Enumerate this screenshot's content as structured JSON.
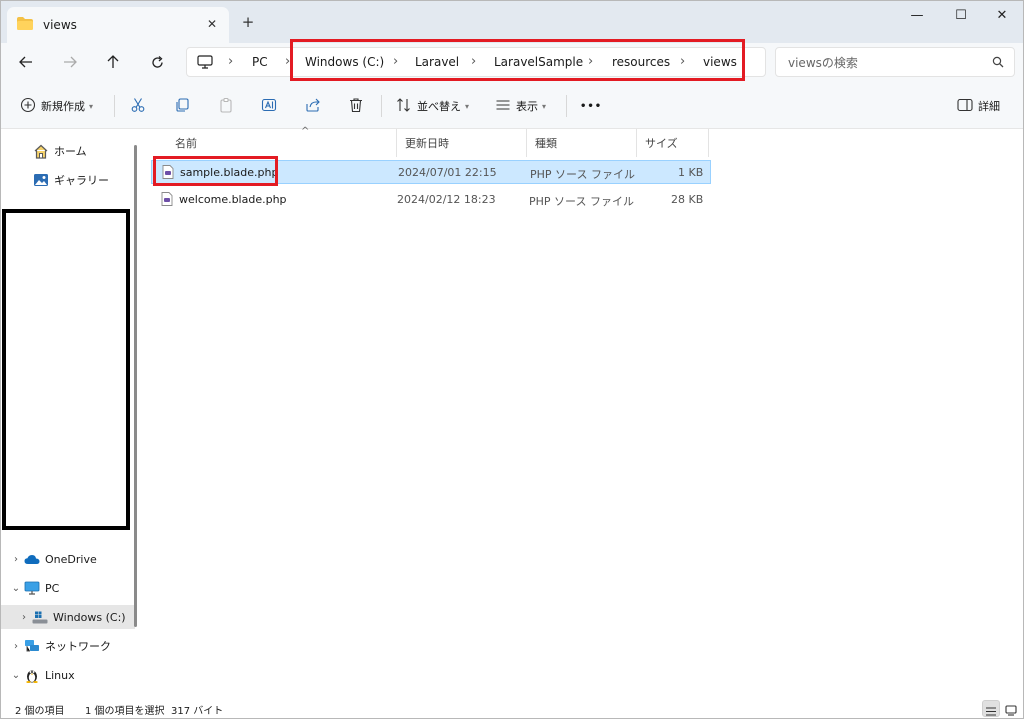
{
  "window": {
    "tab_title": "views",
    "new_tab_symbol": "+",
    "close_tab_symbol": "✕",
    "controls": {
      "minimize": "—",
      "maximize": "☐",
      "close": "✕"
    }
  },
  "address": {
    "breadcrumbs": [
      "PC",
      "Windows (C:)",
      "Laravel",
      "LaravelSample",
      "resources",
      "views"
    ],
    "search_placeholder": "viewsの検索"
  },
  "toolbar": {
    "new_label": "新規作成",
    "sort_label": "並べ替え",
    "view_label": "表示",
    "more_label": "•••",
    "details_label": "詳細"
  },
  "sidebar": {
    "quick": [
      {
        "label": "ホーム",
        "icon": "home-icon"
      },
      {
        "label": "ギャラリー",
        "icon": "gallery-icon"
      }
    ],
    "tree": [
      {
        "label": "OneDrive",
        "icon": "cloud-icon",
        "chevron": "›"
      },
      {
        "label": "PC",
        "icon": "pc-icon",
        "chevron": "⌄"
      },
      {
        "label": "Windows (C:)",
        "icon": "drive-icon",
        "chevron": "›",
        "selected": true
      },
      {
        "label": "ネットワーク",
        "icon": "network-icon",
        "chevron": "›"
      },
      {
        "label": "Linux",
        "icon": "linux-icon",
        "chevron": "⌄"
      }
    ]
  },
  "files": {
    "columns": [
      "名前",
      "更新日時",
      "種類",
      "サイズ"
    ],
    "rows": [
      {
        "name": "sample.blade.php",
        "modified": "2024/07/01 22:15",
        "type": "PHP ソース ファイル",
        "size": "1 KB",
        "selected": true
      },
      {
        "name": "welcome.blade.php",
        "modified": "2024/02/12 18:23",
        "type": "PHP ソース ファイル",
        "size": "28 KB",
        "selected": false
      }
    ]
  },
  "status": {
    "item_count": "2 個の項目",
    "selection": "1 個の項目を選択",
    "selection_size": "317 バイト"
  },
  "colors": {
    "highlight": "#e31b23",
    "selection_bg": "#cce8ff",
    "chrome_bg": "#f6f8fa",
    "tab_bar_bg": "#e3e9f0"
  }
}
